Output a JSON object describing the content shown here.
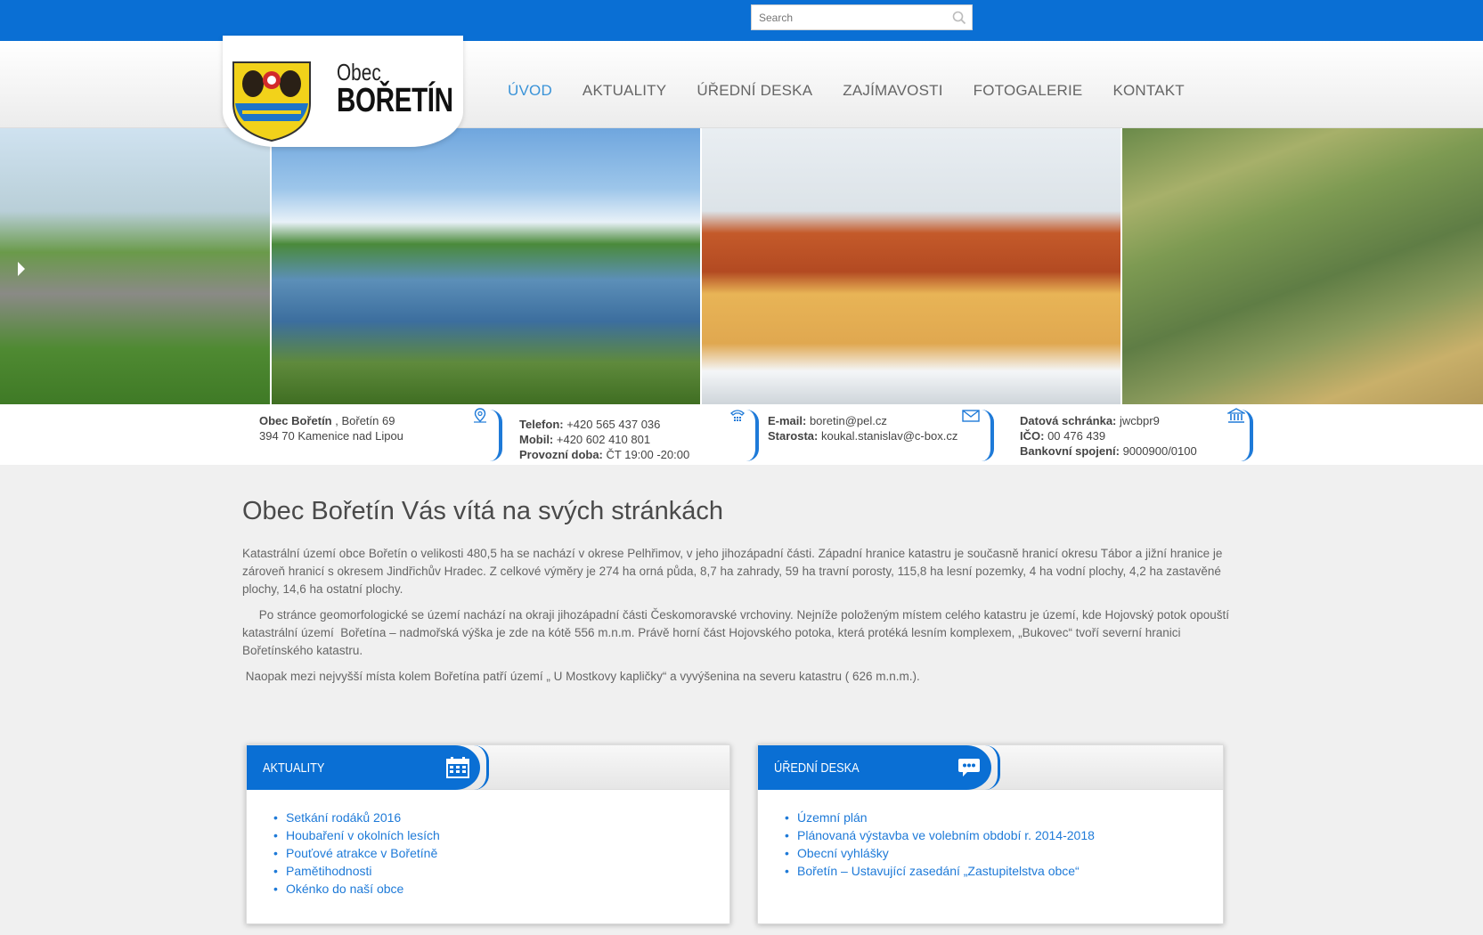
{
  "search": {
    "placeholder": "Search"
  },
  "brand": {
    "line1": "Obec",
    "line2": "BOŘETÍN"
  },
  "nav": [
    {
      "label": "ÚVOD",
      "active": true
    },
    {
      "label": "AKTUALITY"
    },
    {
      "label": "ÚŘEDNÍ DESKA"
    },
    {
      "label": "ZAJÍMAVOSTI"
    },
    {
      "label": "FOTOGALERIE"
    },
    {
      "label": "KONTAKT"
    }
  ],
  "contact": {
    "address": {
      "name": "Obec Bořetín",
      "street": " , Bořetín 69",
      "city": "394 70  Kamenice nad Lipou"
    },
    "phone": {
      "tel_label": "Telefon:",
      "tel": " +420 565 437 036",
      "mob_label": "Mobil:",
      "mob": " +420 602 410 801",
      "hours_label": "Provozní doba:",
      "hours": " ČT 19:00 -20:00"
    },
    "email": {
      "email_label": "E-mail:",
      "email": " boretin@pel.cz",
      "mayor_label": "Starosta:",
      "mayor": "  koukal.stanislav@c-box.cz"
    },
    "bank": {
      "ds_label": "Datová schránka:",
      "ds": " jwcbpr9",
      "ico_label": "IČO:",
      "ico": " 00 476 439",
      "bank_label": "Bankovní spojení:",
      "bank": " 9000900/0100"
    }
  },
  "main": {
    "title": "Obec Bořetín Vás vítá na svých stránkách",
    "paragraphs": [
      "Katastrální území obce Bořetín  o velikosti 480,5 ha se nachází v okrese Pelhřimov, v jeho jihozápadní části. Západní hranice katastru je současně hranicí  okresu Tábor a jižní hranice je zároveň hranicí s okresem Jindřichův Hradec. Z celkové výměry je 274 ha orná půda, 8,7 ha zahrady, 59 ha travní porosty, 115,8 ha lesní pozemky, 4 ha vodní plochy, 4,2 ha zastavěné plochy, 14,6 ha ostatní plochy.",
      "     Po stránce geomorfologické se území nachází na okraji jihozápadní části Českomoravské vrchoviny. Nejníže položeným místem celého katastru je území, kde Hojovský potok opouští katastrální území  Bořetína – nadmořská výška je zde na kótě 556 m.n.m. Právě horní část Hojovského potoka, která protéká lesním komplexem, „Bukovec“ tvoří severní hranici Bořetínského katastru.",
      " Naopak mezi nejvyšší místa kolem Bořetína patří území „ U Mostkovy kapličky“ a vyvýšenina na severu katastru ( 626 m.n.m.)."
    ]
  },
  "aktuality": {
    "heading": "AKTUALITY",
    "items": [
      "Setkání rodáků 2016",
      "Houbaření v okolních lesích",
      "Pouťové atrakce v Bořetíně",
      "Pamětihodnosti",
      "Okénko do naší obce"
    ]
  },
  "deska": {
    "heading": "ÚŘEDNÍ DESKA",
    "items": [
      "Územní plán",
      "Plánovaná výstavba ve volebním období r. 2014-2018",
      "Obecní vyhlášky",
      "Bořetín – Ustavující zasedání „Zastupitelstva obce“"
    ]
  },
  "colors": {
    "brand_blue": "#0a6fd4",
    "link_blue": "#1e7ad8",
    "active_nav": "#3a93d8"
  }
}
